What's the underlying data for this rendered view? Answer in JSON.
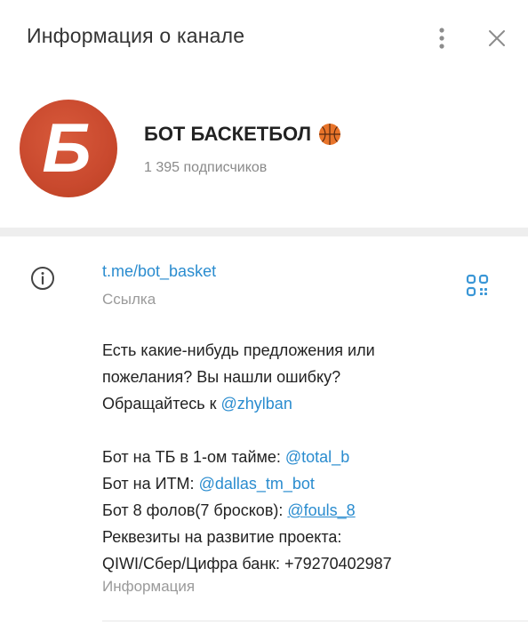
{
  "header": {
    "title": "Информация о канале",
    "more_icon": "more-vertical-icon",
    "close_icon": "close-icon"
  },
  "channel": {
    "avatar_letter": "Б",
    "avatar_color": "#c9492e",
    "name": "БОТ БАСКЕТБОЛ",
    "name_emoji_icon": "basketball-icon",
    "subscribers": "1 395 подписчиков"
  },
  "info": {
    "info_icon": "info-icon",
    "link": "t.me/bot_basket",
    "link_label": "Ссылка",
    "qr_icon": "qr-code-icon",
    "description": {
      "l1": "Есть какие-нибудь предложения или",
      "l2": "пожелания? Вы нашли ошибку?",
      "l3_text": "Обращайтесь к ",
      "l3_mention": "@zhylban",
      "l4_text": "Бот на ТБ в 1-ом тайме: ",
      "l4_mention": "@total_b",
      "l5_text": "Бот на ИТМ: ",
      "l5_mention": "@dallas_tm_bot",
      "l6_text": "Бот 8 фолов(7 бросков): ",
      "l6_mention": "@fouls_8",
      "l7": "Реквезиты на развитие проекта:",
      "l8": "QIWI/Сбер/Цифра банк: +79270402987"
    },
    "description_label": "Информация"
  },
  "colors": {
    "link": "#2a8ccf",
    "muted": "#9a9a9a",
    "band": "#eeeeee"
  }
}
